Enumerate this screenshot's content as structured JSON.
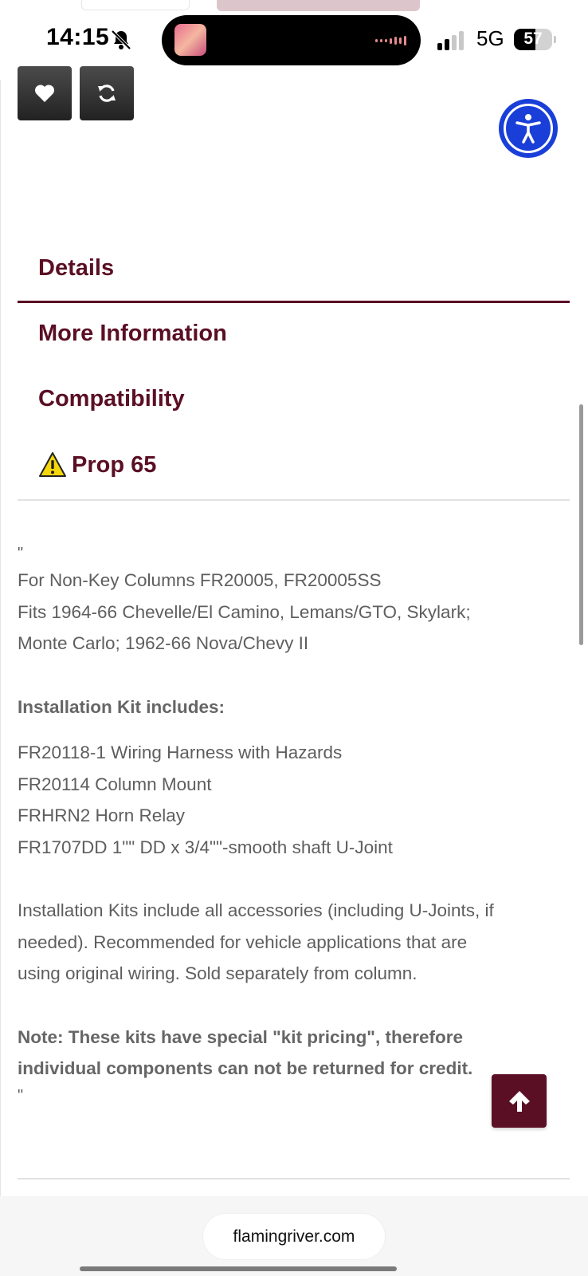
{
  "status_bar": {
    "time": "14:15",
    "network": "5G",
    "battery": "57",
    "battery_level": 0.57
  },
  "actions": {
    "wishlist_icon": "heart-icon",
    "compare_icon": "refresh-icon",
    "accessibility_icon": "accessibility-icon"
  },
  "tabs": [
    {
      "label": "Details",
      "active": true
    },
    {
      "label": "More Information",
      "active": false
    },
    {
      "label": "Compatibility",
      "active": false
    },
    {
      "label": "Prop 65",
      "active": false,
      "icon": "warning-icon"
    }
  ],
  "content": {
    "open_quote": "\"",
    "columns_line": "For Non-Key Columns FR20005, FR20005SS",
    "fits_line_1": "Fits 1964-66 Chevelle/El Camino, Lemans/GTO, Skylark;",
    "fits_line_2": "Monte Carlo; 1962-66 Nova/Chevy II",
    "kit_heading": "Installation Kit includes:",
    "kit_items": [
      "FR20118-1 Wiring Harness with Hazards",
      "FR20114 Column Mount",
      "FRHRN2 Horn Relay",
      "FR1707DD 1\"\" DD x 3/4\"\"-smooth shaft U-Joint"
    ],
    "description_lines": [
      "Installation Kits include all accessories (including U-Joints, if",
      "needed). Recommended for vehicle applications that are",
      "using original wiring. Sold separately from column."
    ],
    "note_lines": [
      "Note: These kits have special \"kit pricing\", therefore",
      "individual components can not be returned for credit."
    ],
    "close_quote": "\""
  },
  "back_to_top_icon": "arrow-up-icon",
  "browser": {
    "url": "flamingriver.com"
  },
  "colors": {
    "brand": "#5a0f24",
    "accessibility": "#1a3fd8"
  }
}
